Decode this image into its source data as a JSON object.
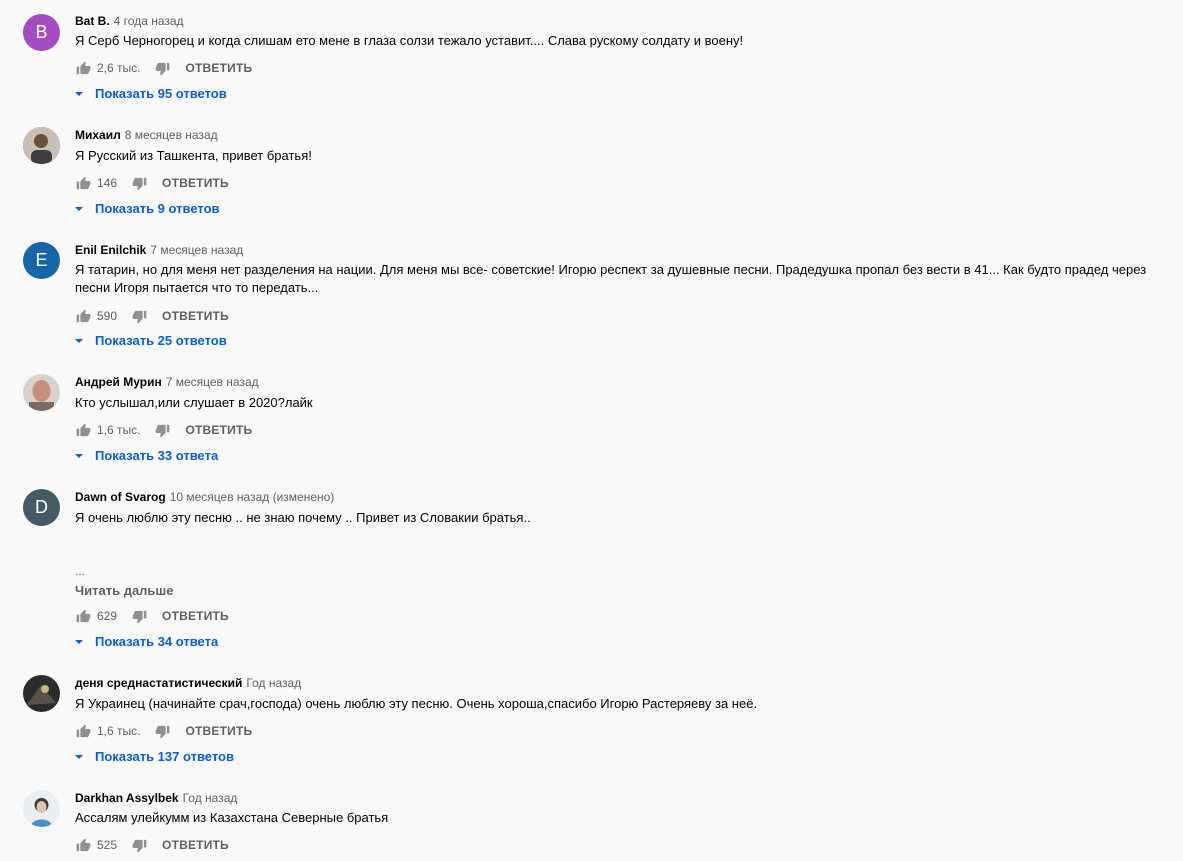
{
  "comments": [
    {
      "author": "Bat B.",
      "time": "4 года назад",
      "text": "Я Серб Черногорец и когда слишам ето мене в глаза солзи тежало уставит.... Слава рускому солдату и воену!",
      "likes": "2,6 тыс.",
      "reply": "ОТВЕТИТЬ",
      "replies": "Показать 95 ответов",
      "avatar": {
        "type": "letter",
        "letter": "B",
        "color": "#a44cc1"
      }
    },
    {
      "author": "Михаил",
      "time": "8 месяцев назад",
      "text": "Я Русский из Ташкента, привет братья!",
      "likes": "146",
      "reply": "ОТВЕТИТЬ",
      "replies": "Показать 9 ответов",
      "avatar": {
        "type": "photo",
        "color": "#7a6a58"
      }
    },
    {
      "author": "Enil Enilchik",
      "time": "7 месяцев назад",
      "text": "Я татарин, но для меня нет разделения на нации. Для меня мы все- советские! Игорю респект за душевные песни. Прадедушка пропал без вести в 41... Как будто прадед через песни Игоря пытается что то передать...",
      "likes": "590",
      "reply": "ОТВЕТИТЬ",
      "replies": "Показать 25 ответов",
      "avatar": {
        "type": "letter",
        "letter": "E",
        "color": "#1565a8"
      }
    },
    {
      "author": "Андрей Мурин",
      "time": "7 месяцев назад",
      "text": "Кто услышал,или слушает  в 2020?лайк",
      "likes": "1,6 тыс.",
      "reply": "ОТВЕТИТЬ",
      "replies": "Показать 33 ответа",
      "avatar": {
        "type": "photo",
        "color": "#b07a6a"
      }
    },
    {
      "author": "Dawn of Svarog",
      "time": "10 месяцев назад (изменено)",
      "text": "Я очень люблю эту песню .. не знаю почему .. Привет из Словакии братья..",
      "ellipsis": "...",
      "read_more": "Читать дальше",
      "likes": "629",
      "reply": "ОТВЕТИТЬ",
      "replies": "Показать 34 ответа",
      "avatar": {
        "type": "letter",
        "letter": "D",
        "color": "#455a64"
      }
    },
    {
      "author": "деня среднастатистический",
      "time": "Год назад",
      "text": "Я Украинец (начинайте срач,господа) очень люблю эту песню. Очень хороша,спасибо Игорю Растеряеву за неё.",
      "likes": "1,6 тыс.",
      "reply": "ОТВЕТИТЬ",
      "replies": "Показать 137 ответов",
      "avatar": {
        "type": "photo",
        "color": "#2b2b2b"
      }
    },
    {
      "author": "Darkhan Assylbek",
      "time": "Год назад",
      "text": "Ассалям улейкумм из Казахстана Северные братья",
      "likes": "525",
      "reply": "ОТВЕТИТЬ",
      "replies": "",
      "avatar": {
        "type": "photo",
        "color": "#e9eef2"
      }
    }
  ]
}
